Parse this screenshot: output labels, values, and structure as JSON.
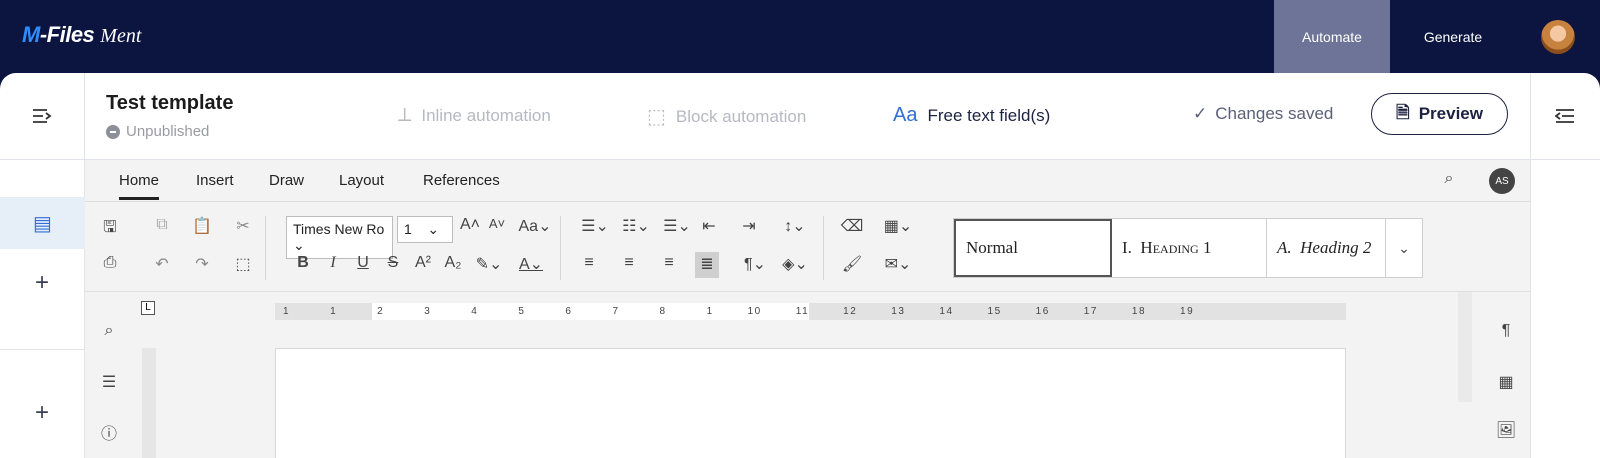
{
  "app": {
    "brand": "M-Files",
    "product": "Ment"
  },
  "topnav": {
    "items": [
      {
        "label": "Automate",
        "active": true
      },
      {
        "label": "Generate",
        "active": false
      }
    ]
  },
  "header": {
    "title": "Test template",
    "status": "Unpublished",
    "tools": {
      "inline": "Inline automation",
      "block": "Block automation",
      "free": "Free text field(s)"
    },
    "saved": "Changes saved",
    "preview": "Preview"
  },
  "editor": {
    "tabs": [
      "Home",
      "Insert",
      "Draw",
      "Layout",
      "References"
    ],
    "user_initials": "AS",
    "font_name": "Times New Ro",
    "font_size": "1",
    "styles": {
      "normal": "Normal",
      "h1_num": "I.",
      "h1": "Heading 1",
      "h2_num": "A.",
      "h2": "Heading 2"
    },
    "ruler": [
      "1",
      "1",
      "2",
      "3",
      "4",
      "5",
      "6",
      "7",
      "8",
      "1",
      "10",
      "11",
      "12",
      "13",
      "14",
      "15",
      "16",
      "17",
      "18",
      "19"
    ]
  },
  "colors": {
    "nav_bg": "#0b1540",
    "nav_active": "#6d7497",
    "accent": "#2f6fd6"
  }
}
